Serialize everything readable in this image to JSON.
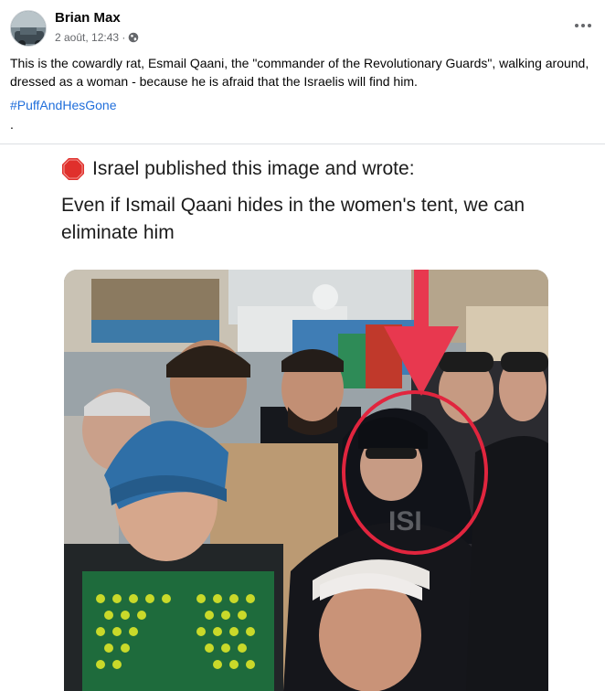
{
  "post": {
    "author": "Brian Max",
    "timestamp": "2 août, 12:43 ·",
    "audience_icon": "globe-icon",
    "text": "This is the cowardly rat, Esmail Qaani, the \"commander of the Revolutionary Guards\", walking around, dressed as a woman - because he is afraid that the Israelis will find him.",
    "hashtag": "#PuffAndHesGone",
    "extra_line": "."
  },
  "media": {
    "tweet_title": "Israel published this image and wrote:",
    "tweet_body": "Even if Ismail Qaani hides in the women's tent, we can eliminate him",
    "watermark": "ISI"
  },
  "colors": {
    "link": "#216fdb",
    "secondary_text": "#65676b",
    "arrow_red": "#e8384f",
    "circle_red": "#e1253e",
    "stop_red": "#e0302c"
  }
}
